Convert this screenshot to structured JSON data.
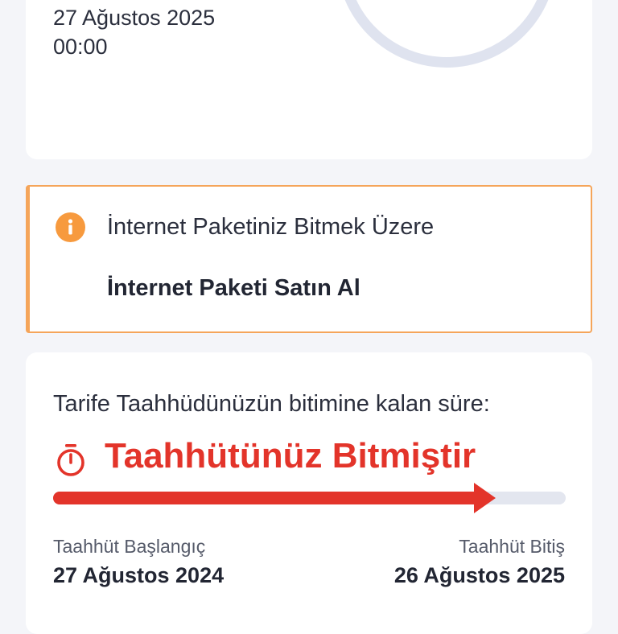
{
  "usage_card": {
    "date_line": "27 Ağustos 2025",
    "time_line": "00:00"
  },
  "warning": {
    "icon": "info-icon",
    "title": "İnternet Paketiniz Bitmek Üzere",
    "action_label": "İnternet Paketi Satın Al",
    "accent_color": "#f5a55a"
  },
  "commitment": {
    "label": "Tarife Taahhüdünüzün bitimine kalan süre:",
    "status_icon": "timer-icon",
    "status": "Taahhütünüz Bitmiştir",
    "status_color": "#e3342a",
    "progress": 0.86,
    "start_label": "Taahhüt Başlangıç",
    "start_date": "27 Ağustos 2024",
    "end_label": "Taahhüt Bitiş",
    "end_date": "26 Ağustos 2025"
  }
}
